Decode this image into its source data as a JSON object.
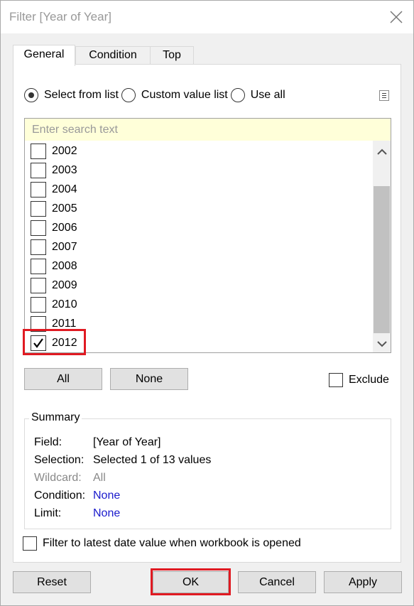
{
  "window": {
    "title": "Filter [Year of Year]"
  },
  "tabs": [
    {
      "label": "General",
      "active": true
    },
    {
      "label": "Condition",
      "active": false
    },
    {
      "label": "Top",
      "active": false
    }
  ],
  "mode": {
    "options": [
      {
        "label": "Select from list",
        "selected": true
      },
      {
        "label": "Custom value list",
        "selected": false
      },
      {
        "label": "Use all",
        "selected": false
      }
    ]
  },
  "list": {
    "search_placeholder": "Enter search text",
    "items": [
      {
        "label": "2002",
        "checked": false
      },
      {
        "label": "2003",
        "checked": false
      },
      {
        "label": "2004",
        "checked": false
      },
      {
        "label": "2005",
        "checked": false
      },
      {
        "label": "2006",
        "checked": false
      },
      {
        "label": "2007",
        "checked": false
      },
      {
        "label": "2008",
        "checked": false
      },
      {
        "label": "2009",
        "checked": false
      },
      {
        "label": "2010",
        "checked": false
      },
      {
        "label": "2011",
        "checked": false
      },
      {
        "label": "2012",
        "checked": true
      }
    ]
  },
  "buttons": {
    "all": "All",
    "none": "None",
    "exclude": "Exclude",
    "reset": "Reset",
    "ok": "OK",
    "cancel": "Cancel",
    "apply": "Apply"
  },
  "summary": {
    "legend": "Summary",
    "rows": [
      {
        "key": "Field:",
        "value": "[Year of Year]",
        "style": "normal"
      },
      {
        "key": "Selection:",
        "value": "Selected 1 of 13 values",
        "style": "normal"
      },
      {
        "key": "Wildcard:",
        "value": "All",
        "style": "muted"
      },
      {
        "key": "Condition:",
        "value": "None",
        "style": "link"
      },
      {
        "key": "Limit:",
        "value": "None",
        "style": "link"
      }
    ]
  },
  "latest_date_option": {
    "label": "Filter to latest date value when workbook is opened",
    "checked": false
  },
  "colors": {
    "highlight": "#e01a22",
    "link": "#1a1acc",
    "search_bg": "#ffffd9"
  }
}
